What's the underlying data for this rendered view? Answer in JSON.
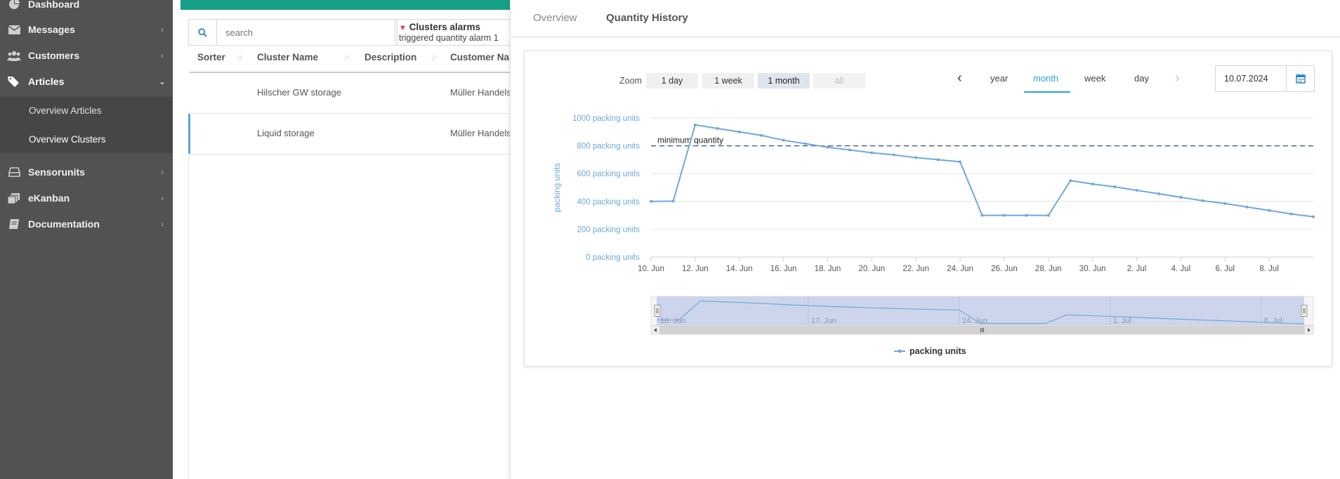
{
  "sidebar": {
    "items": [
      {
        "label": "Dashboard",
        "icon": "dashboard-icon"
      },
      {
        "label": "Messages",
        "icon": "envelope-icon"
      },
      {
        "label": "Customers",
        "icon": "users-icon"
      },
      {
        "label": "Articles",
        "icon": "tags-icon"
      },
      {
        "label": "Sensorunits",
        "icon": "drive-icon"
      },
      {
        "label": "eKanban",
        "icon": "stack-icon"
      },
      {
        "label": "Documentation",
        "icon": "book-icon"
      }
    ],
    "sub_items": [
      {
        "label": "Overview Articles"
      },
      {
        "label": "Overview Clusters"
      }
    ]
  },
  "list": {
    "search_placeholder": "search",
    "filter_title": "Clusters alarms",
    "filter_value": "triggered quantity alarm 1",
    "columns": [
      "Sorter",
      "Cluster Name",
      "Description",
      "Customer Name"
    ],
    "rows": [
      {
        "sorter": "",
        "name": "Hilscher GW storage",
        "description": "",
        "customer": "Müller Handels"
      },
      {
        "sorter": "",
        "name": "Liquid storage",
        "description": "",
        "customer": "Müller Handels"
      }
    ]
  },
  "panel": {
    "tabs": [
      {
        "label": "Overview"
      },
      {
        "label": "Quantity History"
      }
    ],
    "zoom_label": "Zoom",
    "zoom_options": [
      "1 day",
      "1 week",
      "1 month",
      "all"
    ],
    "zoom_selected": "1 month",
    "periods": [
      "year",
      "month",
      "week",
      "day"
    ],
    "period_selected": "month",
    "date_value": "10.07.2024",
    "accent_color": "#2f9be0"
  },
  "chart_data": {
    "type": "line",
    "ylabel": "packing units",
    "yticks": [
      "0 packing units",
      "200 packing units",
      "400 packing units",
      "600 packing units",
      "800 packing units",
      "1000 packing units"
    ],
    "ylim": [
      0,
      1000
    ],
    "xticks": [
      "10. Jun",
      "12. Jun",
      "14. Jun",
      "16. Jun",
      "18. Jun",
      "20. Jun",
      "22. Jun",
      "24. Jun",
      "26. Jun",
      "28. Jun",
      "30. Jun",
      "2. Jul",
      "4. Jul",
      "6. Jul",
      "8. Jul"
    ],
    "xlim": [
      "2024-06-10",
      "2024-07-10"
    ],
    "grid": true,
    "threshold": {
      "label": "minimum quantity",
      "value": 800
    },
    "navigator_labels": [
      "10. Jun",
      "17. Jun",
      "24. Jun",
      "1. Jul",
      "8. Jul"
    ],
    "legend": "bottom-center",
    "series": [
      {
        "name": "packing units",
        "color": "#6fa8dc",
        "points": [
          {
            "x": "2024-06-10",
            "y": 400
          },
          {
            "x": "2024-06-11",
            "y": 402
          },
          {
            "x": "2024-06-12",
            "y": 950
          },
          {
            "x": "2024-06-13",
            "y": 925
          },
          {
            "x": "2024-06-14",
            "y": 900
          },
          {
            "x": "2024-06-15",
            "y": 875
          },
          {
            "x": "2024-06-16",
            "y": 840
          },
          {
            "x": "2024-06-17",
            "y": 815
          },
          {
            "x": "2024-06-18",
            "y": 790
          },
          {
            "x": "2024-06-19",
            "y": 770
          },
          {
            "x": "2024-06-20",
            "y": 750
          },
          {
            "x": "2024-06-21",
            "y": 735
          },
          {
            "x": "2024-06-22",
            "y": 715
          },
          {
            "x": "2024-06-23",
            "y": 700
          },
          {
            "x": "2024-06-24",
            "y": 685
          },
          {
            "x": "2024-06-25",
            "y": 300
          },
          {
            "x": "2024-06-26",
            "y": 300
          },
          {
            "x": "2024-06-27",
            "y": 300
          },
          {
            "x": "2024-06-28",
            "y": 300
          },
          {
            "x": "2024-06-29",
            "y": 550
          },
          {
            "x": "2024-06-30",
            "y": 525
          },
          {
            "x": "2024-07-01",
            "y": 505
          },
          {
            "x": "2024-07-02",
            "y": 480
          },
          {
            "x": "2024-07-03",
            "y": 455
          },
          {
            "x": "2024-07-04",
            "y": 430
          },
          {
            "x": "2024-07-05",
            "y": 405
          },
          {
            "x": "2024-07-06",
            "y": 385
          },
          {
            "x": "2024-07-07",
            "y": 360
          },
          {
            "x": "2024-07-08",
            "y": 335
          },
          {
            "x": "2024-07-09",
            "y": 310
          },
          {
            "x": "2024-07-10",
            "y": 290
          }
        ]
      }
    ]
  }
}
